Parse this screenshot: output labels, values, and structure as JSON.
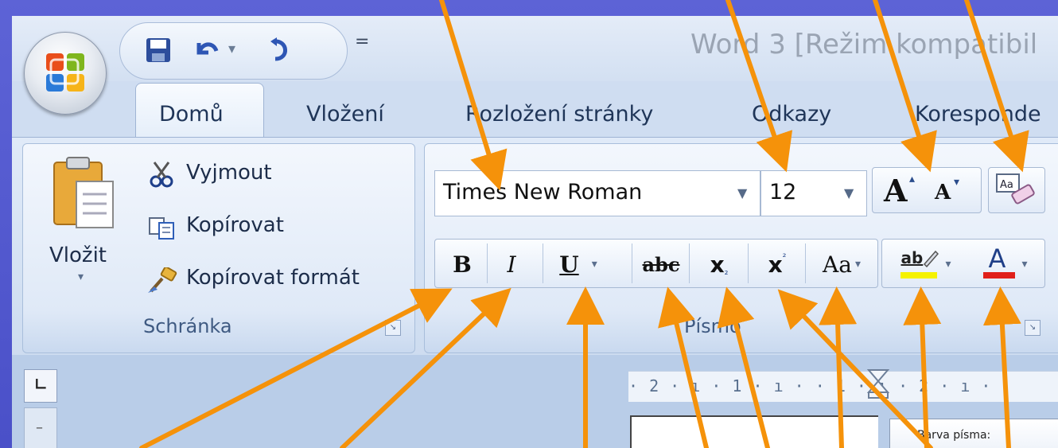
{
  "window": {
    "title": "Word 3 [Režim kompatibil"
  },
  "qat": {
    "customize_glyph": "="
  },
  "tabs": [
    {
      "label": "Domů"
    },
    {
      "label": "Vložení"
    },
    {
      "label": "Rozložení stránky"
    },
    {
      "label": "Odkazy"
    },
    {
      "label": "Koresponde"
    }
  ],
  "clipboard": {
    "paste_label": "Vložit",
    "cut_label": "Vyjmout",
    "copy_label": "Kopírovat",
    "format_painter_label": "Kopírovat formát",
    "group_label": "Schránka"
  },
  "font": {
    "group_label": "Písmo",
    "font_name": "Times New Roman",
    "font_size": "12",
    "grow_label": "A",
    "shrink_label": "A",
    "bold_label": "B",
    "italic_label": "I",
    "underline_label": "U",
    "strike_label": "abc",
    "subscript_label": "x",
    "superscript_label": "x",
    "case_label": "Aa",
    "highlight_label": "ab",
    "color_label": "A"
  },
  "ruler": {
    "text": "· 2 · ı · 1 · ı ·   · 1 · ı · 2 · ı ·"
  },
  "tooltip": {
    "text": "Barva písma:"
  },
  "colors": {
    "highlight": "#f5f200",
    "font_color": "#e0201a",
    "arrow": "#f5920a"
  }
}
